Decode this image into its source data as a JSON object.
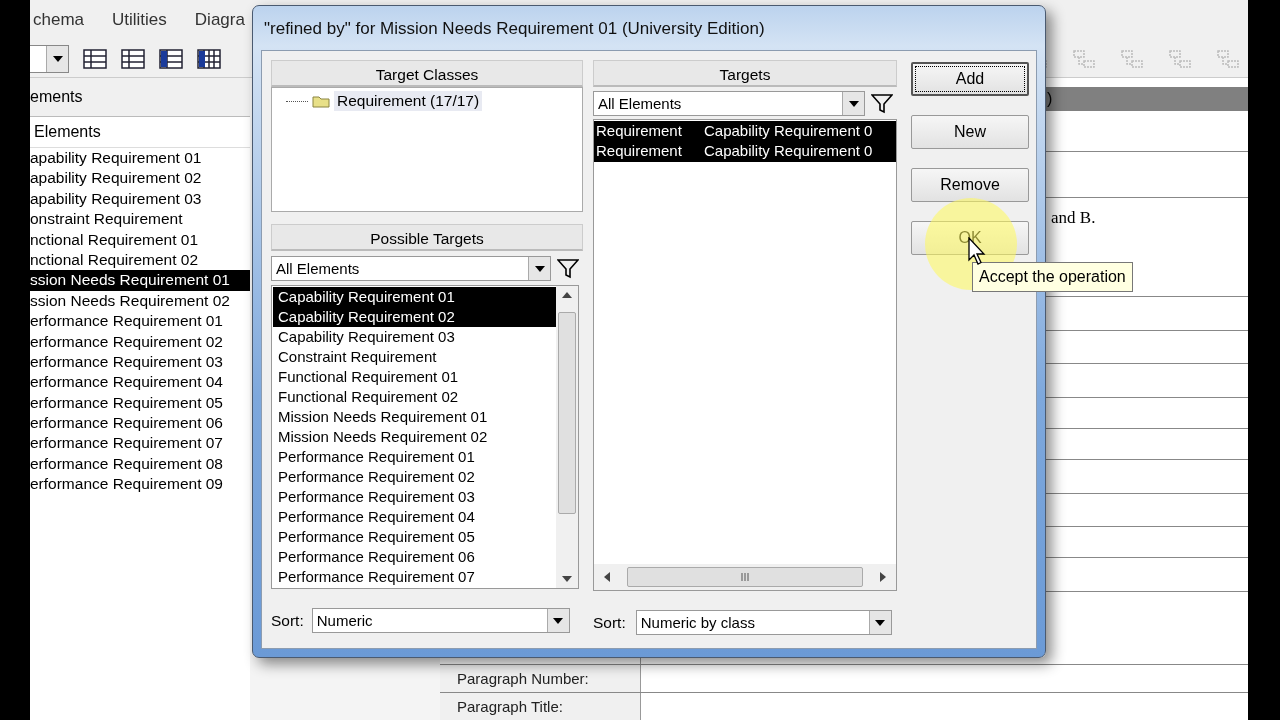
{
  "app": {
    "menu": [
      "chema",
      "Utilities",
      "Diagra"
    ],
    "left_panel": {
      "header": "ements",
      "subheader": "Elements",
      "items": [
        {
          "label": "apability Requirement 01",
          "selected": false
        },
        {
          "label": "apability Requirement 02",
          "selected": false
        },
        {
          "label": "apability Requirement 03",
          "selected": false
        },
        {
          "label": "onstraint Requirement",
          "selected": false
        },
        {
          "label": "nctional Requirement 01",
          "selected": false
        },
        {
          "label": "nctional Requirement 02",
          "selected": false
        },
        {
          "label": "ssion Needs Requirement 01",
          "selected": true
        },
        {
          "label": "ssion Needs Requirement 02",
          "selected": false
        },
        {
          "label": "erformance Requirement 01",
          "selected": false
        },
        {
          "label": "erformance Requirement 02",
          "selected": false
        },
        {
          "label": "erformance Requirement 03",
          "selected": false
        },
        {
          "label": "erformance Requirement 04",
          "selected": false
        },
        {
          "label": "erformance Requirement 05",
          "selected": false
        },
        {
          "label": "erformance Requirement 06",
          "selected": false
        },
        {
          "label": "erformance Requirement 07",
          "selected": false
        },
        {
          "label": "erformance Requirement 08",
          "selected": false
        },
        {
          "label": "erformance Requirement 09",
          "selected": false
        }
      ]
    },
    "right_panel": {
      "header_fragment": ")",
      "text_fragment": "and B.",
      "fields": [
        {
          "label": "Paragraph Number:"
        },
        {
          "label": "Paragraph Title:"
        }
      ]
    }
  },
  "dialog": {
    "title": "\"refined by\" for Mission Needs Requirement 01 (University Edition)",
    "target_classes": {
      "header": "Target Classes",
      "items": [
        {
          "label": "Requirement (17/17)"
        }
      ]
    },
    "possible_targets": {
      "header": "Possible Targets",
      "filter": "All Elements",
      "sort_label": "Sort:",
      "sort": "Numeric",
      "items": [
        {
          "label": "Capability Requirement 01",
          "selected": true
        },
        {
          "label": "Capability Requirement 02",
          "selected": true
        },
        {
          "label": "Capability Requirement 03",
          "selected": false
        },
        {
          "label": "Constraint Requirement",
          "selected": false
        },
        {
          "label": "Functional Requirement 01",
          "selected": false
        },
        {
          "label": "Functional Requirement 02",
          "selected": false
        },
        {
          "label": "Mission Needs Requirement 01",
          "selected": false
        },
        {
          "label": "Mission Needs Requirement 02",
          "selected": false
        },
        {
          "label": "Performance Requirement 01",
          "selected": false
        },
        {
          "label": "Performance Requirement 02",
          "selected": false
        },
        {
          "label": "Performance Requirement 03",
          "selected": false
        },
        {
          "label": "Performance Requirement 04",
          "selected": false
        },
        {
          "label": "Performance Requirement 05",
          "selected": false
        },
        {
          "label": "Performance Requirement 06",
          "selected": false
        },
        {
          "label": "Performance Requirement 07",
          "selected": false
        }
      ]
    },
    "targets": {
      "header": "Targets",
      "filter": "All Elements",
      "sort_label": "Sort:",
      "sort": "Numeric by class",
      "rows": [
        {
          "class": "Requirement",
          "name": "Capability Requirement 0",
          "selected": true
        },
        {
          "class": "Requirement",
          "name": "Capability Requirement 0",
          "selected": true
        }
      ]
    },
    "buttons": [
      {
        "label": "Add",
        "focused": true
      },
      {
        "label": "New",
        "focused": false
      },
      {
        "label": "Remove",
        "focused": false
      },
      {
        "label": "OK",
        "focused": false
      }
    ],
    "tooltip": "Accept the operation"
  }
}
